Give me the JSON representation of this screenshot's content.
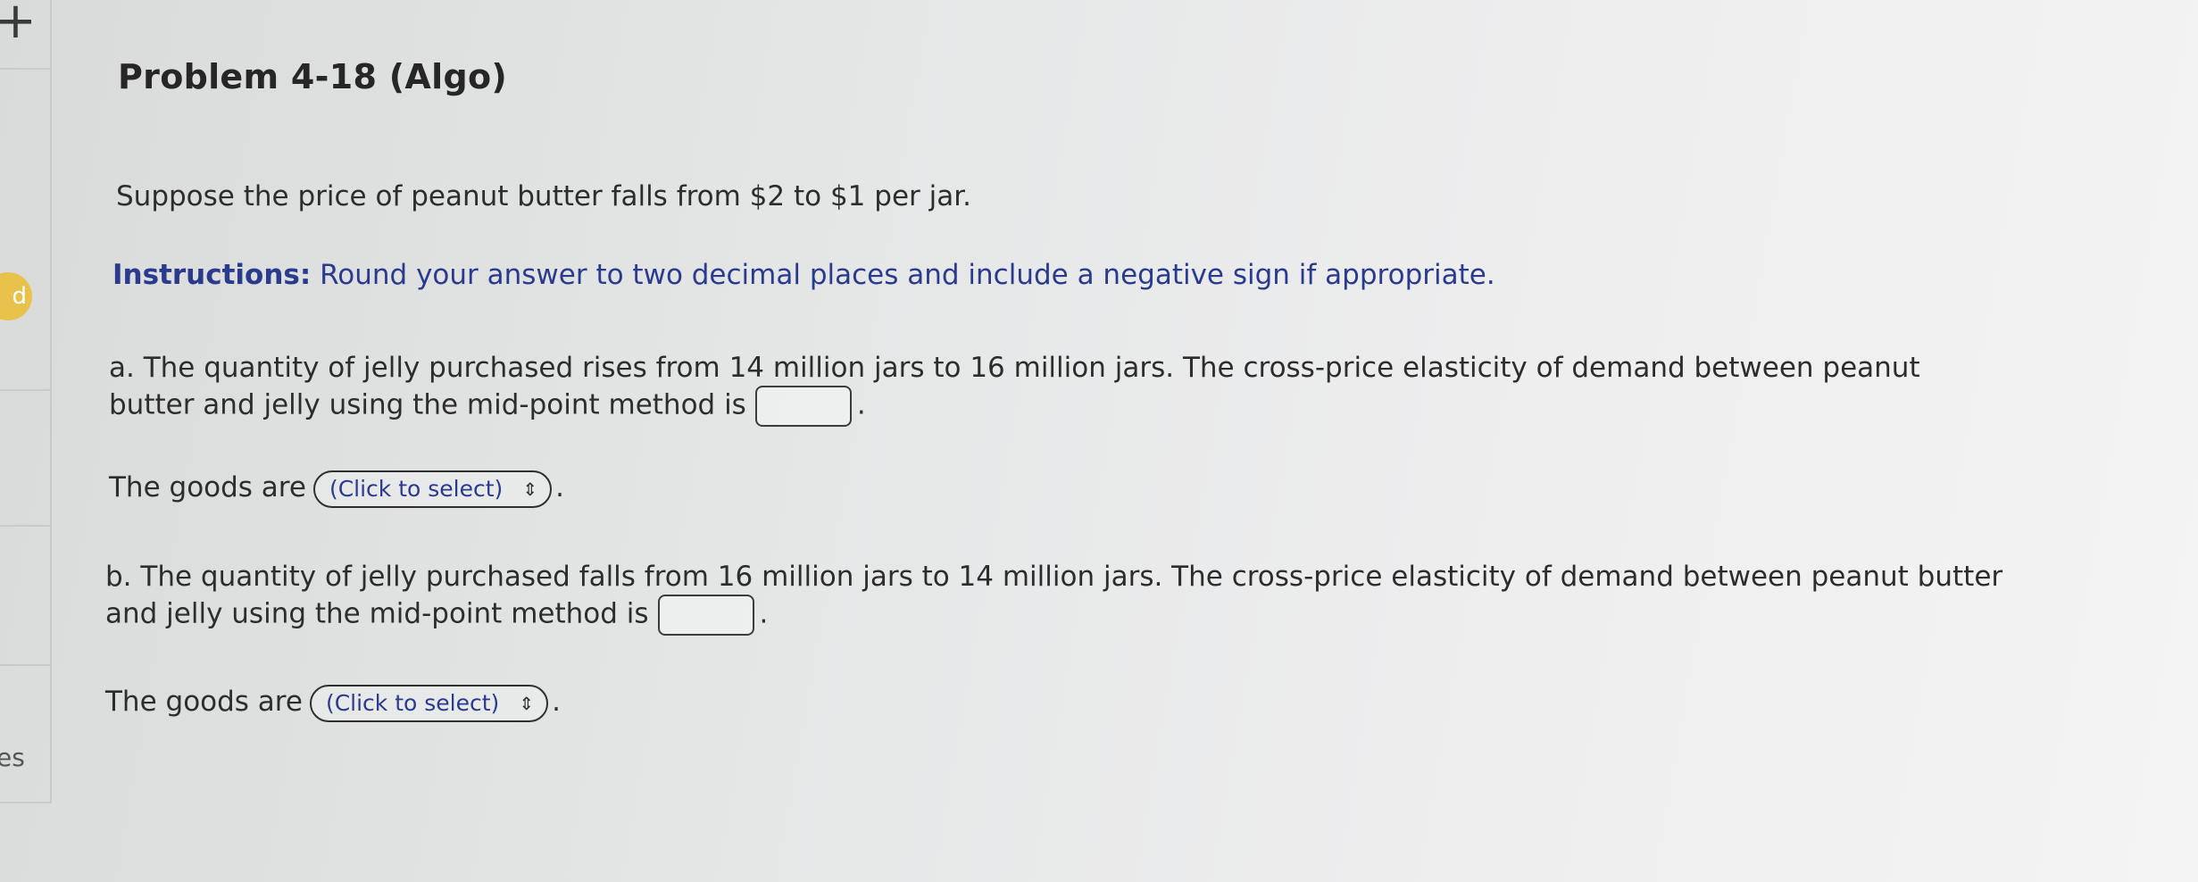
{
  "sidebar": {
    "badge_text": "d",
    "bottom_text": "es"
  },
  "problem": {
    "title": "Problem 4-18 (Algo)",
    "intro": "Suppose the price of peanut butter falls from $2 to $1 per jar.",
    "instructions_label": "Instructions:",
    "instructions_text": " Round your answer to two decimal places and include a negative sign if appropriate."
  },
  "part_a": {
    "line1": "a. The quantity of jelly purchased rises from 14 million jars to 16 million jars. The cross-price elasticity of demand between peanut",
    "line2": "butter and jelly using the mid-point method is",
    "answer_value": "",
    "goods_label": "The goods are",
    "select_value": "(Click to select)"
  },
  "part_b": {
    "line1": "b. The quantity of jelly purchased falls from 16 million jars to 14 million jars. The cross-price elasticity of demand between peanut butter",
    "line2": "and jelly using the mid-point method is",
    "answer_value": "",
    "goods_label": "The goods are",
    "select_value": "(Click to select)"
  },
  "punctuation": {
    "period": "."
  },
  "colors": {
    "instructions": "#2a3a8e",
    "badge": "#e8c24a",
    "text": "#2d2d2d"
  }
}
